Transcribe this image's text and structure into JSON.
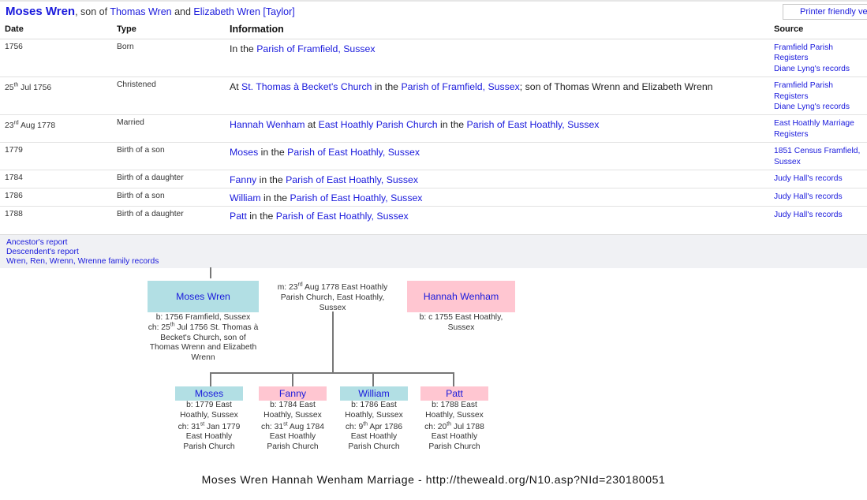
{
  "header": {
    "name": "Moses Wren",
    "son_of_text": ", son of ",
    "father": "Thomas Wren",
    "and_text": " and ",
    "mother": "Elizabeth Wren [Taylor]",
    "printer_label": "Printer friendly version"
  },
  "table": {
    "headers": {
      "date": "Date",
      "type": "Type",
      "info": "Information",
      "source": "Source"
    },
    "rows": [
      {
        "date": "1756",
        "type": "Born",
        "info_parts": [
          {
            "text": "In the ",
            "link": false
          },
          {
            "text": "Parish of Framfield, Sussex",
            "link": true
          }
        ],
        "sources": [
          "Framfield Parish Registers",
          "Diane Lyng's records"
        ]
      },
      {
        "date_day": "25",
        "date_sup": "th",
        "date_rest": " Jul 1756",
        "type": "Christened",
        "info_parts": [
          {
            "text": "At ",
            "link": false
          },
          {
            "text": "St. Thomas à Becket's Church",
            "link": true
          },
          {
            "text": " in the ",
            "link": false
          },
          {
            "text": "Parish of Framfield, Sussex",
            "link": true
          },
          {
            "text": "; son of Thomas Wrenn and Elizabeth Wrenn",
            "link": false
          }
        ],
        "sources": [
          "Framfield Parish Registers",
          "Diane Lyng's records"
        ]
      },
      {
        "date_day": "23",
        "date_sup": "rd",
        "date_rest": " Aug 1778",
        "type": "Married",
        "info_parts": [
          {
            "text": "Hannah Wenham",
            "link": true
          },
          {
            "text": " at ",
            "link": false
          },
          {
            "text": "East Hoathly Parish Church",
            "link": true
          },
          {
            "text": " in the ",
            "link": false
          },
          {
            "text": "Parish of East Hoathly, Sussex",
            "link": true
          }
        ],
        "sources": [
          "East Hoathly Marriage Registers"
        ]
      },
      {
        "date": "1779",
        "type": "Birth of a son",
        "info_parts": [
          {
            "text": "Moses",
            "link": true
          },
          {
            "text": " in the ",
            "link": false
          },
          {
            "text": "Parish of East Hoathly, Sussex",
            "link": true
          }
        ],
        "sources": [
          "1851 Census Framfield, Sussex"
        ]
      },
      {
        "date": "1784",
        "type": "Birth of a daughter",
        "info_parts": [
          {
            "text": "Fanny",
            "link": true
          },
          {
            "text": " in the ",
            "link": false
          },
          {
            "text": "Parish of East Hoathly, Sussex",
            "link": true
          }
        ],
        "sources": [
          "Judy Hall's records"
        ]
      },
      {
        "date": "1786",
        "type": "Birth of a son",
        "info_parts": [
          {
            "text": "William",
            "link": true
          },
          {
            "text": " in the ",
            "link": false
          },
          {
            "text": "Parish of East Hoathly, Sussex",
            "link": true
          }
        ],
        "sources": [
          "Judy Hall's records"
        ]
      },
      {
        "date": "1788",
        "type": "Birth of a daughter",
        "info_parts": [
          {
            "text": "Patt",
            "link": true
          },
          {
            "text": " in the ",
            "link": false
          },
          {
            "text": "Parish of East Hoathly, Sussex",
            "link": true
          }
        ],
        "sources": [
          "Judy Hall's records"
        ]
      }
    ]
  },
  "reports": {
    "ancestor": "Ancestor's report",
    "descendent": "Descendent's report",
    "family": "Wren, Ren, Wrenn, Wrenne family records"
  },
  "tree": {
    "husband": {
      "name": "Moses Wren",
      "born": "b: 1756 Framfield, Sussex",
      "ch_prefix": "ch: 25",
      "ch_sup": "th",
      "ch_rest": " Jul 1756 St. Thomas à Becket's Church, son of Thomas Wrenn and Elizabeth Wrenn"
    },
    "marriage": {
      "prefix": "m: 23",
      "sup": "rd",
      "rest": " Aug 1778 East Hoathly Parish Church, East Hoathly, Sussex"
    },
    "wife": {
      "name": "Hannah Wenham",
      "born": "b: c 1755 East Hoathly, Sussex"
    },
    "children": [
      {
        "name": "Moses",
        "gender": "m",
        "born": "b: 1779 East Hoathly, Sussex",
        "ch_prefix": "ch: 31",
        "ch_sup": "st",
        "ch_rest": " Jan 1779 East Hoathly Parish Church"
      },
      {
        "name": "Fanny",
        "gender": "f",
        "born": "b: 1784 East Hoathly, Sussex",
        "ch_prefix": "ch: 31",
        "ch_sup": "st",
        "ch_rest": " Aug 1784 East Hoathly Parish Church"
      },
      {
        "name": "William",
        "gender": "m",
        "born": "b: 1786 East Hoathly, Sussex",
        "ch_prefix": "ch: 9",
        "ch_sup": "th",
        "ch_rest": " Apr 1786 East Hoathly Parish Church"
      },
      {
        "name": "Patt",
        "gender": "f",
        "born": "b: 1788 East Hoathly, Sussex",
        "ch_prefix": "ch: 20",
        "ch_sup": "th",
        "ch_rest": " Jul 1788 East Hoathly Parish Church"
      }
    ]
  },
  "caption": "Moses Wren Hannah Wenham Marriage - http://theweald.org/N10.asp?NId=230180051",
  "colors": {
    "link": "#1a1adc",
    "male_box": "#b2dfe4",
    "female_box": "#ffc6d1",
    "reports_bg": "#f0f1f4"
  }
}
